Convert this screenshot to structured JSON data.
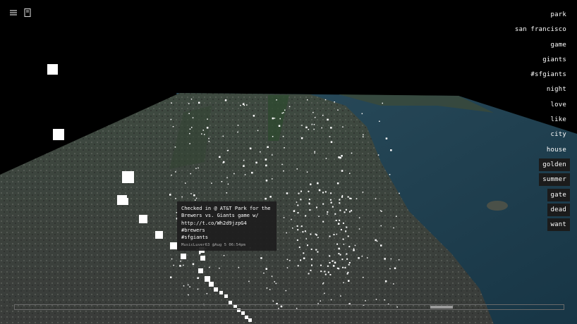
{
  "toolbar": {
    "menu_icon": "hamburger-menu-icon",
    "doc_icon": "document-icon"
  },
  "keywords": [
    {
      "label": "park",
      "highlighted": false
    },
    {
      "label": "san francisco",
      "highlighted": false
    },
    {
      "label": "game",
      "highlighted": false
    },
    {
      "label": "giants",
      "highlighted": false
    },
    {
      "label": "#sfgiants",
      "highlighted": false
    },
    {
      "label": "night",
      "highlighted": false
    },
    {
      "label": "love",
      "highlighted": false
    },
    {
      "label": "like",
      "highlighted": false
    },
    {
      "label": "city",
      "highlighted": false
    },
    {
      "label": "house",
      "highlighted": false
    },
    {
      "label": "golden",
      "highlighted": true
    },
    {
      "label": "summer",
      "highlighted": true
    },
    {
      "label": "gate",
      "highlighted": true
    },
    {
      "label": "dead",
      "highlighted": true
    },
    {
      "label": "want",
      "highlighted": true
    }
  ],
  "tooltip": {
    "line1": "Checked in @ AT&T Park for the",
    "line2": "Brewers vs. Giants game w/",
    "line3": "http://t.co/Wh2d9jzpG4 #brewers",
    "line4": "#sfgiants",
    "meta": "MusicLuver63 @Aug 5 06:54pm"
  },
  "timeline": {
    "position": 0.79
  },
  "colors": {
    "background": "#000000",
    "water": "#1f3f52",
    "land": "#3b3f3c",
    "points": "#ffffff"
  }
}
